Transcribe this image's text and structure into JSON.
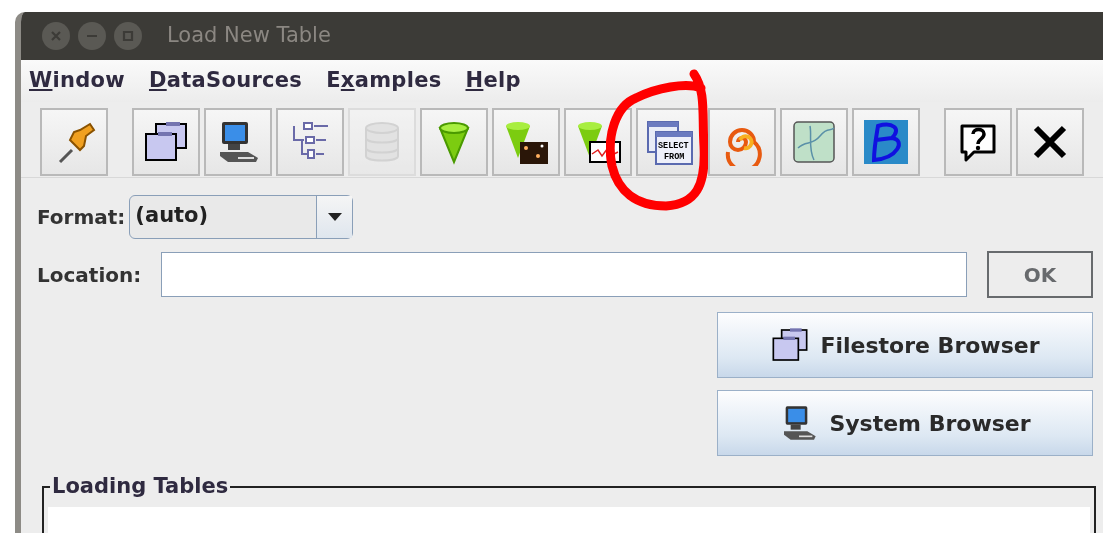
{
  "window": {
    "title": "Load New Table"
  },
  "menu": [
    {
      "key": "W",
      "post": "indow"
    },
    {
      "key": "D",
      "post": "ataSources"
    },
    {
      "pre": "E",
      "key": "x",
      "post": "amples"
    },
    {
      "key": "H",
      "post": "elp"
    }
  ],
  "toolbar_groups": [
    [
      {
        "kind": "pin",
        "disabled": false,
        "highlighted": false
      }
    ],
    [
      {
        "kind": "folders",
        "disabled": false,
        "highlighted": false
      },
      {
        "kind": "computer",
        "disabled": false,
        "highlighted": false
      },
      {
        "kind": "tree",
        "disabled": false,
        "highlighted": false
      },
      {
        "kind": "database",
        "disabled": true,
        "highlighted": false
      },
      {
        "kind": "cone",
        "disabled": false,
        "highlighted": false
      },
      {
        "kind": "cone-sky",
        "disabled": false,
        "highlighted": false
      },
      {
        "kind": "cone-plot",
        "disabled": false,
        "highlighted": false
      },
      {
        "kind": "sql",
        "disabled": false,
        "highlighted": true,
        "lines": [
          "SELECT",
          "FROM"
        ]
      },
      {
        "kind": "spiral",
        "disabled": false,
        "highlighted": false
      },
      {
        "kind": "map",
        "disabled": false,
        "highlighted": false
      },
      {
        "kind": "letter-b",
        "disabled": false,
        "highlighted": false
      }
    ],
    [
      {
        "kind": "help",
        "disabled": false,
        "highlighted": false
      },
      {
        "kind": "close",
        "disabled": false,
        "highlighted": false
      }
    ]
  ],
  "format": {
    "label": "Format:",
    "value": "(auto)"
  },
  "location": {
    "label": "Location:",
    "ok_button": {
      "label": "OK",
      "disabled": true
    }
  },
  "browser_buttons": [
    {
      "kind": "folders",
      "label": "Filestore Browser"
    },
    {
      "kind": "computer",
      "label": "System Browser"
    }
  ],
  "loading_tables": {
    "title": "Loading Tables"
  }
}
